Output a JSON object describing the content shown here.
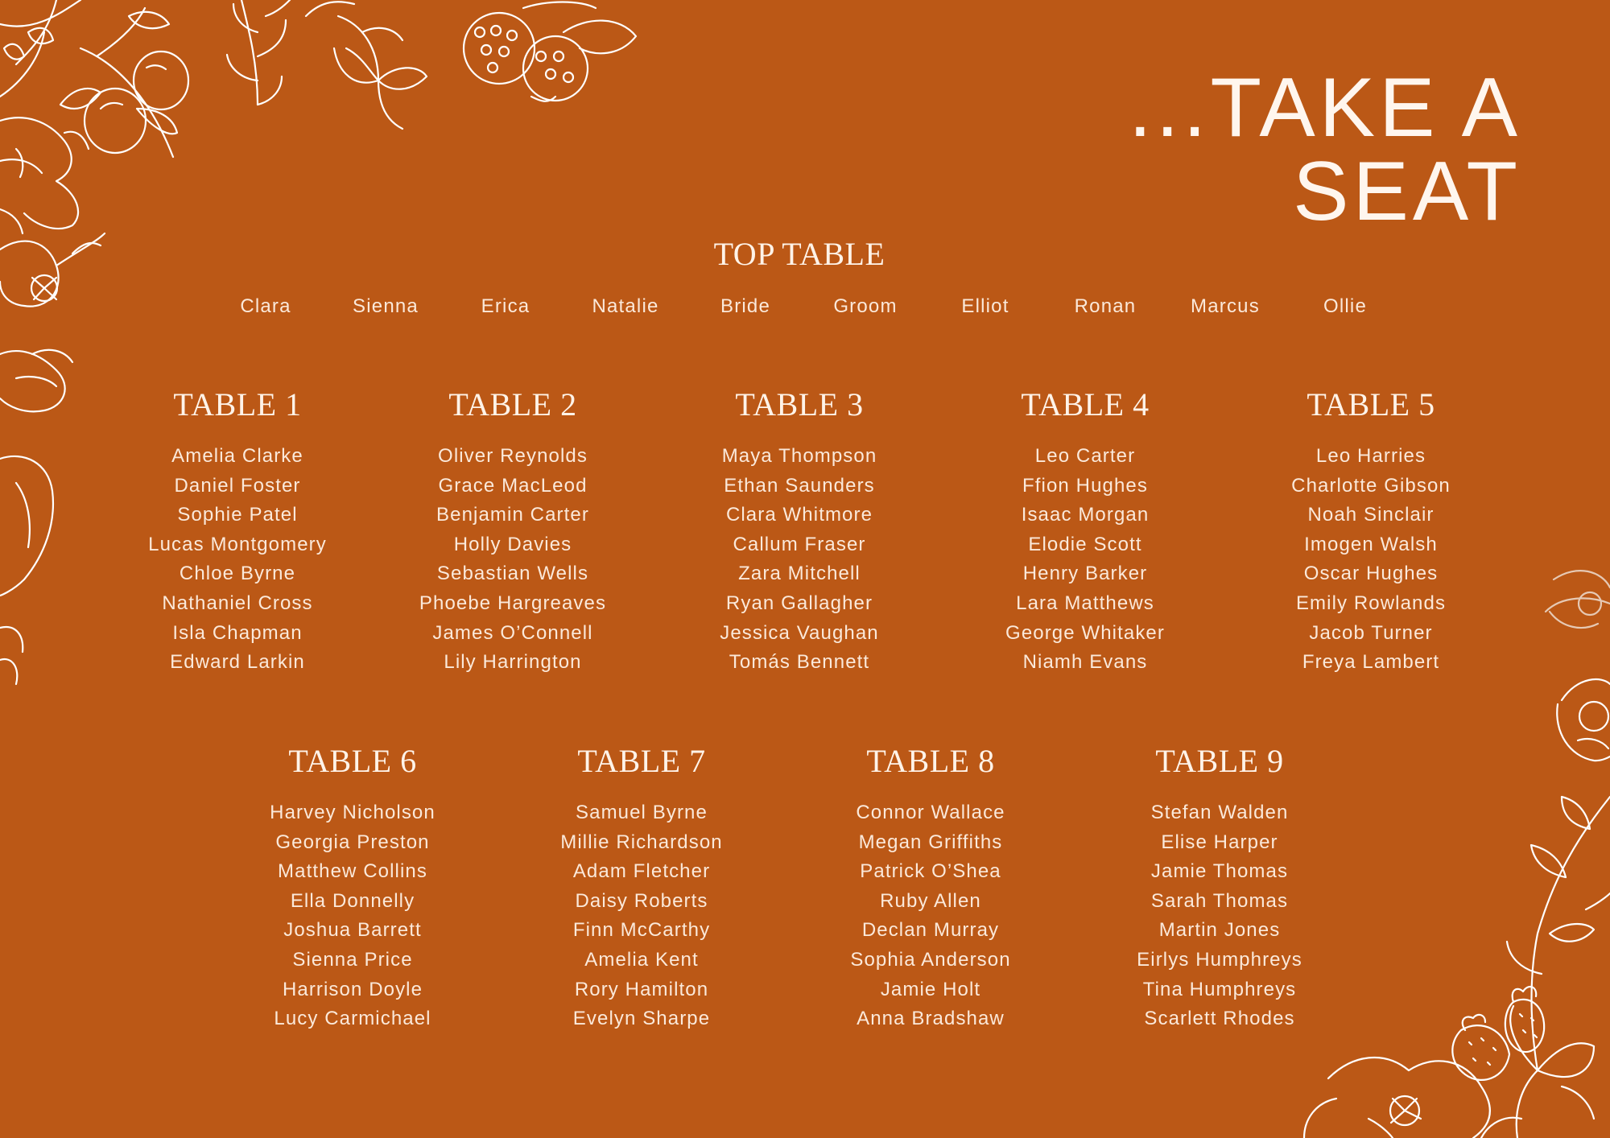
{
  "title": "...TAKE A SEAT",
  "top_table": {
    "heading": "TOP TABLE",
    "names": [
      "Clara",
      "Sienna",
      "Erica",
      "Natalie",
      "Bride",
      "Groom",
      "Elliot",
      "Ronan",
      "Marcus",
      "Ollie"
    ]
  },
  "tables": [
    {
      "heading": "TABLE 1",
      "guests": [
        "Amelia Clarke",
        "Daniel Foster",
        "Sophie Patel",
        "Lucas Montgomery",
        "Chloe Byrne",
        "Nathaniel Cross",
        "Isla Chapman",
        "Edward Larkin"
      ]
    },
    {
      "heading": "TABLE 2",
      "guests": [
        "Oliver Reynolds",
        "Grace MacLeod",
        "Benjamin Carter",
        "Holly Davies",
        "Sebastian Wells",
        "Phoebe Hargreaves",
        "James O’Connell",
        "Lily Harrington"
      ]
    },
    {
      "heading": "TABLE 3",
      "guests": [
        "Maya Thompson",
        "Ethan Saunders",
        "Clara Whitmore",
        "Callum Fraser",
        "Zara Mitchell",
        "Ryan Gallagher",
        "Jessica Vaughan",
        "Tomás Bennett"
      ]
    },
    {
      "heading": "TABLE 4",
      "guests": [
        "Leo Carter",
        "Ffion Hughes",
        "Isaac Morgan",
        "Elodie Scott",
        "Henry Barker",
        "Lara Matthews",
        "George Whitaker",
        "Niamh Evans"
      ]
    },
    {
      "heading": "TABLE 5",
      "guests": [
        "Leo Harries",
        "Charlotte Gibson",
        "Noah Sinclair",
        "Imogen Walsh",
        "Oscar Hughes",
        "Emily Rowlands",
        "Jacob Turner",
        "Freya Lambert"
      ]
    },
    {
      "heading": "TABLE 6",
      "guests": [
        "Harvey Nicholson",
        "Georgia Preston",
        "Matthew Collins",
        "Ella Donnelly",
        "Joshua Barrett",
        "Sienna Price",
        "Harrison Doyle",
        "Lucy Carmichael"
      ]
    },
    {
      "heading": "TABLE 7",
      "guests": [
        "Samuel Byrne",
        "Millie Richardson",
        "Adam Fletcher",
        "Daisy Roberts",
        "Finn McCarthy",
        "Amelia Kent",
        "Rory Hamilton",
        "Evelyn Sharpe"
      ]
    },
    {
      "heading": "TABLE 8",
      "guests": [
        "Connor Wallace",
        "Megan Griffiths",
        "Patrick O’Shea",
        "Ruby Allen",
        "Declan Murray",
        "Sophia Anderson",
        "Jamie Holt",
        "Anna Bradshaw"
      ]
    },
    {
      "heading": "TABLE 9",
      "guests": [
        "Stefan Walden",
        "Elise Harper",
        "Jamie Thomas",
        "Sarah Thomas",
        "Martin Jones",
        "Eirlys Humphreys",
        "Tina Humphreys",
        "Scarlett Rhodes"
      ]
    }
  ],
  "colors": {
    "background": "#BB5816",
    "text": "#FBE9DA",
    "illustration": "#FFFFFF"
  },
  "icons": [
    "floral-corner-top-left-illustration",
    "floral-corner-bottom-right-illustration"
  ]
}
